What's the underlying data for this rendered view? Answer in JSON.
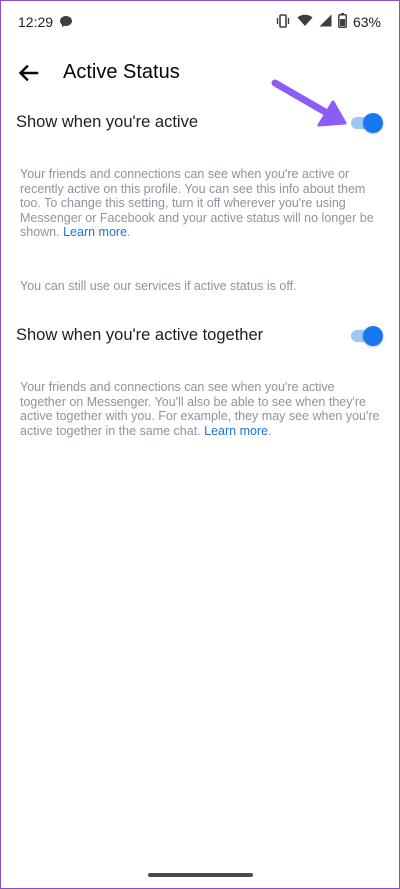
{
  "status_bar": {
    "time": "12:29",
    "battery_percent": "63%",
    "icons": [
      "messenger-bubble-icon",
      "vibrate-icon",
      "wifi-icon",
      "signal-icon",
      "battery-icon"
    ]
  },
  "header": {
    "title": "Active Status",
    "back_icon": "back-arrow-icon"
  },
  "active_setting": {
    "label": "Show when you're active",
    "enabled": true,
    "description": "Your friends and connections can see when you're active or recently active on this profile. You can see this info about them too. To change this setting, turn it off wherever you're using Messenger or Facebook and your active status will no longer be shown.",
    "link": "Learn more"
  },
  "services_note": "You can still use our services if active status is off.",
  "together_setting": {
    "label": "Show when you're active together",
    "enabled": true,
    "description": "Your friends and connections can see when you're active together on Messenger. You'll also be able to see when they're active together with you. For example, they may see when you're active together in the same chat.",
    "link": "Learn more"
  },
  "colors": {
    "accent": "#1877f2",
    "toggle_track": "#9cc8f6",
    "annotation_arrow": "#8b5cf6",
    "secondary_text": "#8d949e"
  }
}
